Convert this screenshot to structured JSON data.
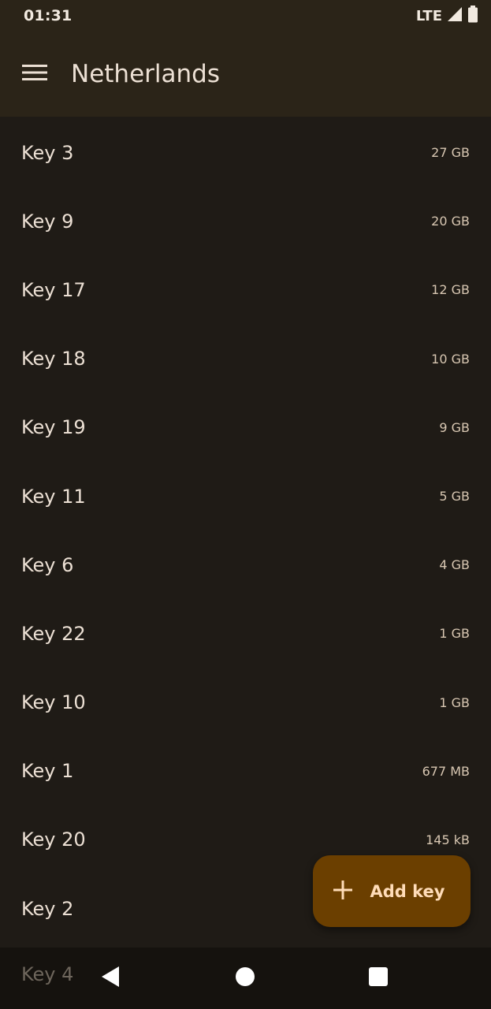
{
  "status_bar": {
    "time": "01:31",
    "network": "LTE",
    "icons": [
      "signal-icon",
      "battery-icon"
    ]
  },
  "app_bar": {
    "menu_icon": "menu-icon",
    "title": "Netherlands"
  },
  "keys": [
    {
      "name": "Key 3",
      "size": "27 GB"
    },
    {
      "name": "Key 9",
      "size": "20 GB"
    },
    {
      "name": "Key 17",
      "size": "12 GB"
    },
    {
      "name": "Key 18",
      "size": "10 GB"
    },
    {
      "name": "Key 19",
      "size": "9 GB"
    },
    {
      "name": "Key 11",
      "size": "5 GB"
    },
    {
      "name": "Key 6",
      "size": "4 GB"
    },
    {
      "name": "Key 22",
      "size": "1 GB"
    },
    {
      "name": "Key 10",
      "size": "1 GB"
    },
    {
      "name": "Key 1",
      "size": "677 MB"
    },
    {
      "name": "Key 20",
      "size": "145 kB"
    },
    {
      "name": "Key 2",
      "size": ""
    }
  ],
  "partially_hidden_key": "Key 4",
  "fab": {
    "icon": "plus-icon",
    "label": "Add key"
  },
  "nav_bar": {
    "icons": [
      "back-icon",
      "home-icon",
      "recents-icon"
    ]
  },
  "colors": {
    "background": "#1f1b16",
    "app_bar": "#2b2418",
    "fab": "#6b3f00",
    "fab_text": "#ffdcb8",
    "nav_bar": "#15120e"
  }
}
